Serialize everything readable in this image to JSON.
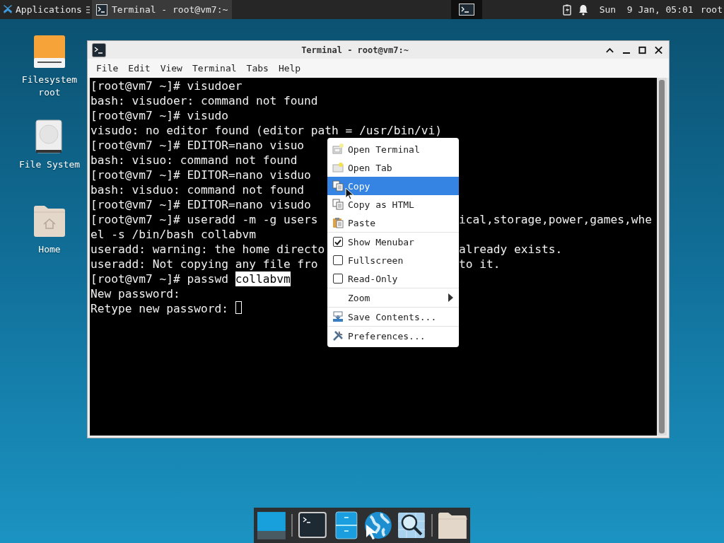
{
  "top_panel": {
    "applications_label": "Applications",
    "tasks": [
      {
        "label": "Terminal - root@vm7:~",
        "selected": true
      }
    ],
    "clock": "Sun  9 Jan, 05:01",
    "user": "root"
  },
  "desktop_icons": [
    {
      "label": "Filesystem root",
      "kind": "drive"
    },
    {
      "label": "File System",
      "kind": "disk"
    },
    {
      "label": "Home",
      "kind": "home"
    }
  ],
  "window": {
    "title": "Terminal - root@vm7:~",
    "menubar": [
      "File",
      "Edit",
      "View",
      "Terminal",
      "Tabs",
      "Help"
    ],
    "terminal": {
      "lines": [
        {
          "text": "[root@vm7 ~]# visudoer"
        },
        {
          "text": "bash: visudoer: command not found"
        },
        {
          "text": "[root@vm7 ~]# visudo"
        },
        {
          "text": "visudo: no editor found (editor path = /usr/bin/vi)"
        },
        {
          "text": "[root@vm7 ~]# EDITOR=nano visuo"
        },
        {
          "text": "bash: visuo: command not found"
        },
        {
          "text": "[root@vm7 ~]# EDITOR=nano visduo"
        },
        {
          "text": "bash: visduo: command not found"
        },
        {
          "text": "[root@vm7 ~]# EDITOR=nano visudo"
        },
        {
          "text": "[root@vm7 ~]# useradd -m -g users",
          "text_right": "ical,storage,power,games,whe"
        },
        {
          "text": "el -s /bin/bash collabvm"
        },
        {
          "text": "useradd: warning: the home directo",
          "text_right": "already exists."
        },
        {
          "text": "useradd: Not copying any file fro",
          "text_right": "to it."
        },
        {
          "text": "[root@vm7 ~]# passwd ",
          "selection": "collabvm"
        },
        {
          "text": "New password:"
        },
        {
          "text": "Retype new password: ",
          "cursor": true
        }
      ]
    }
  },
  "context_menu": {
    "groups": [
      {
        "items": [
          {
            "label": "Open Terminal",
            "kind": "action",
            "selected": false
          },
          {
            "label": "Open Tab",
            "kind": "action",
            "selected": false
          },
          {
            "label": "Copy",
            "kind": "action",
            "selected": true
          },
          {
            "label": "Copy as HTML",
            "kind": "action",
            "selected": false
          },
          {
            "label": "Paste",
            "kind": "action",
            "selected": false
          }
        ]
      },
      {
        "items": [
          {
            "label": "Show Menubar",
            "kind": "check",
            "checked": true,
            "selected": false
          },
          {
            "label": "Fullscreen",
            "kind": "check",
            "checked": false,
            "selected": false
          },
          {
            "label": "Read-Only",
            "kind": "check",
            "checked": false,
            "selected": false
          }
        ]
      },
      {
        "items": [
          {
            "label": "Zoom",
            "kind": "submenu",
            "selected": false
          }
        ]
      },
      {
        "items": [
          {
            "label": "Save Contents...",
            "kind": "action",
            "selected": false
          }
        ]
      },
      {
        "items": [
          {
            "label": "Preferences...",
            "kind": "action",
            "selected": false
          }
        ]
      }
    ]
  },
  "dock": {
    "items": [
      {
        "kind": "desktop"
      },
      {
        "kind": "separator"
      },
      {
        "kind": "terminal"
      },
      {
        "kind": "files"
      },
      {
        "kind": "browser"
      },
      {
        "kind": "search"
      },
      {
        "kind": "separator"
      },
      {
        "kind": "folder"
      }
    ]
  }
}
